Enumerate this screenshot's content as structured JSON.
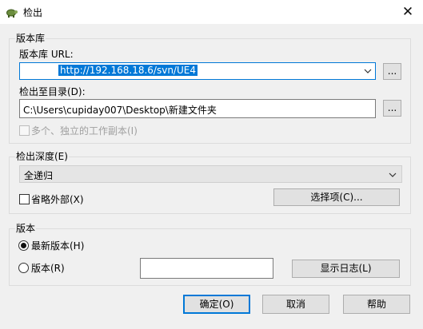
{
  "window": {
    "title": "检出",
    "close_glyph": "✕"
  },
  "repository": {
    "group_label": "版本库",
    "url_label": "版本库 URL:",
    "url_value": "http://192.168.18.6/svn/UE4",
    "browse_label": "...",
    "checkout_dir_label": "检出至目录(D):",
    "checkout_dir_value": "C:\\Users\\cupiday007\\Desktop\\新建文件夹",
    "browse_dir_label": "...",
    "independent_copy_label": "多个、独立的工作副本(I)"
  },
  "depth": {
    "group_label": "检出深度(E)",
    "selected": "全递归",
    "omit_externals_label": "省略外部(X)",
    "choose_items_label": "选择项(C)..."
  },
  "revision": {
    "group_label": "版本",
    "head_label": "最新版本(H)",
    "head_selected": true,
    "revision_label": "版本(R)",
    "revision_value": "",
    "show_log_label": "显示日志(L)"
  },
  "footer": {
    "ok_label": "确定(O)",
    "cancel_label": "取消",
    "help_label": "帮助"
  }
}
